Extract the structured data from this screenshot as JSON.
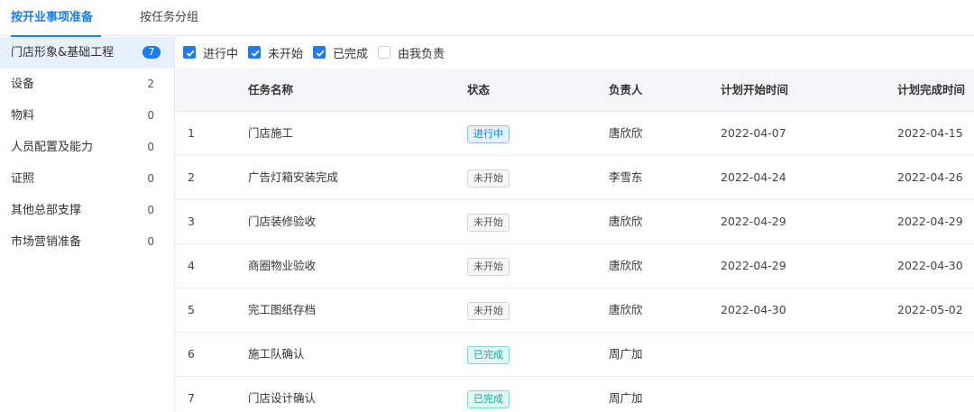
{
  "tabs": [
    {
      "label": "按开业事项准备",
      "active": true
    },
    {
      "label": "按任务分组",
      "active": false
    }
  ],
  "sidebar": {
    "items": [
      {
        "label": "门店形象&基础工程",
        "count": "7",
        "active": true
      },
      {
        "label": "设备",
        "count": "2"
      },
      {
        "label": "物料",
        "count": "0"
      },
      {
        "label": "人员配置及能力",
        "count": "0"
      },
      {
        "label": "证照",
        "count": "0"
      },
      {
        "label": "其他总部支撑",
        "count": "0"
      },
      {
        "label": "市场营销准备",
        "count": "0"
      }
    ]
  },
  "filters": [
    {
      "label": "进行中",
      "checked": true
    },
    {
      "label": "未开始",
      "checked": true
    },
    {
      "label": "已完成",
      "checked": true
    },
    {
      "label": "由我负责",
      "checked": false
    }
  ],
  "table": {
    "columns": {
      "name": "任务名称",
      "status": "状态",
      "owner": "负责人",
      "start": "计划开始时间",
      "end": "计划完成时间"
    },
    "rows": [
      {
        "num": "1",
        "name": "门店施工",
        "status": "进行中",
        "status_type": "progress",
        "owner": "唐欣欣",
        "start": "2022-04-07",
        "end": "2022-04-15"
      },
      {
        "num": "2",
        "name": "广告灯箱安装完成",
        "status": "未开始",
        "status_type": "pending",
        "owner": "李雪东",
        "start": "2022-04-24",
        "end": "2022-04-26"
      },
      {
        "num": "3",
        "name": "门店装修验收",
        "status": "未开始",
        "status_type": "pending",
        "owner": "唐欣欣",
        "start": "2022-04-29",
        "end": "2022-04-29"
      },
      {
        "num": "4",
        "name": "商圈物业验收",
        "status": "未开始",
        "status_type": "pending",
        "owner": "唐欣欣",
        "start": "2022-04-29",
        "end": "2022-04-30"
      },
      {
        "num": "5",
        "name": "完工图纸存档",
        "status": "未开始",
        "status_type": "pending",
        "owner": "唐欣欣",
        "start": "2022-04-30",
        "end": "2022-05-02"
      },
      {
        "num": "6",
        "name": "施工队确认",
        "status": "已完成",
        "status_type": "done",
        "owner": "周广加",
        "start": "",
        "end": ""
      },
      {
        "num": "7",
        "name": "门店设计确认",
        "status": "已完成",
        "status_type": "done",
        "owner": "周广加",
        "start": "",
        "end": ""
      }
    ]
  },
  "colors": {
    "accent": "#1a7df0",
    "done": "#13a89e"
  }
}
